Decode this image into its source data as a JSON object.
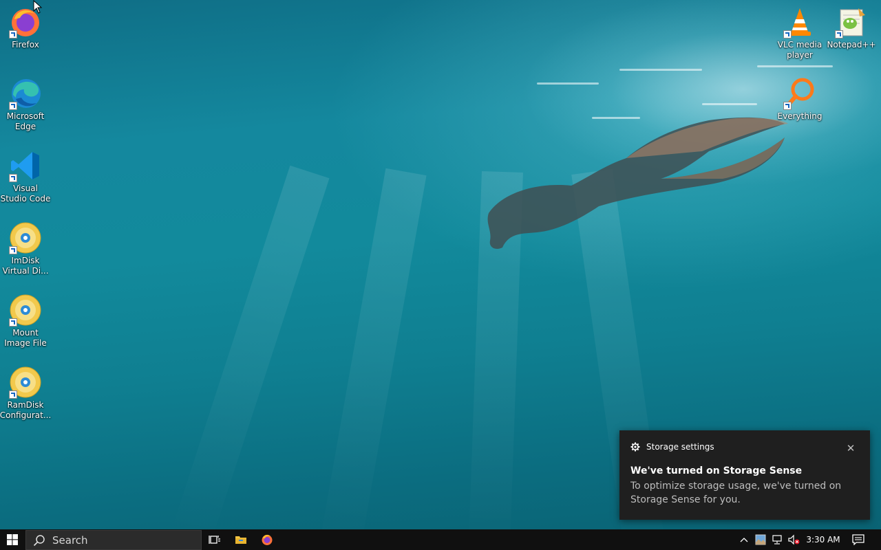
{
  "desktop": {
    "icons_left": [
      {
        "label": "Firefox",
        "icon": "firefox-icon"
      },
      {
        "label": "Microsoft Edge",
        "icon": "edge-icon"
      },
      {
        "label": "Visual Studio Code",
        "icon": "vscode-icon"
      },
      {
        "label": "ImDisk Virtual Di...",
        "icon": "imdisk-disc-icon"
      },
      {
        "label": "Mount Image File",
        "icon": "mount-disc-icon"
      },
      {
        "label": "RamDisk Configurat...",
        "icon": "ramdisk-disc-icon"
      }
    ],
    "icons_right": [
      {
        "label": "VLC media player",
        "icon": "vlc-icon"
      },
      {
        "label": "Notepad++",
        "icon": "notepadpp-icon"
      },
      {
        "label": "Everything",
        "icon": "everything-search-icon"
      }
    ]
  },
  "notification": {
    "app_name": "Storage settings",
    "app_icon": "gear-icon",
    "close_glyph": "✕",
    "title": "We've turned on Storage Sense",
    "body": "To optimize storage usage, we've turned on Storage Sense for you."
  },
  "taskbar": {
    "search_placeholder": "Search",
    "pinned": [
      "task-view-icon",
      "file-explorer-icon",
      "firefox-icon"
    ],
    "tray_icons": [
      "chevron-up-icon",
      "image-app-icon",
      "network-icon",
      "volume-muted-icon"
    ],
    "clock": "3:30 AM",
    "action_center_icon": "notification-icon"
  },
  "colors": {
    "water_top": "#0f6e86",
    "water_mid": "#14889e",
    "taskbar_bg": "#101010",
    "toast_bg": "#1f1f1f",
    "toast_body_text": "#bdbdbd"
  }
}
